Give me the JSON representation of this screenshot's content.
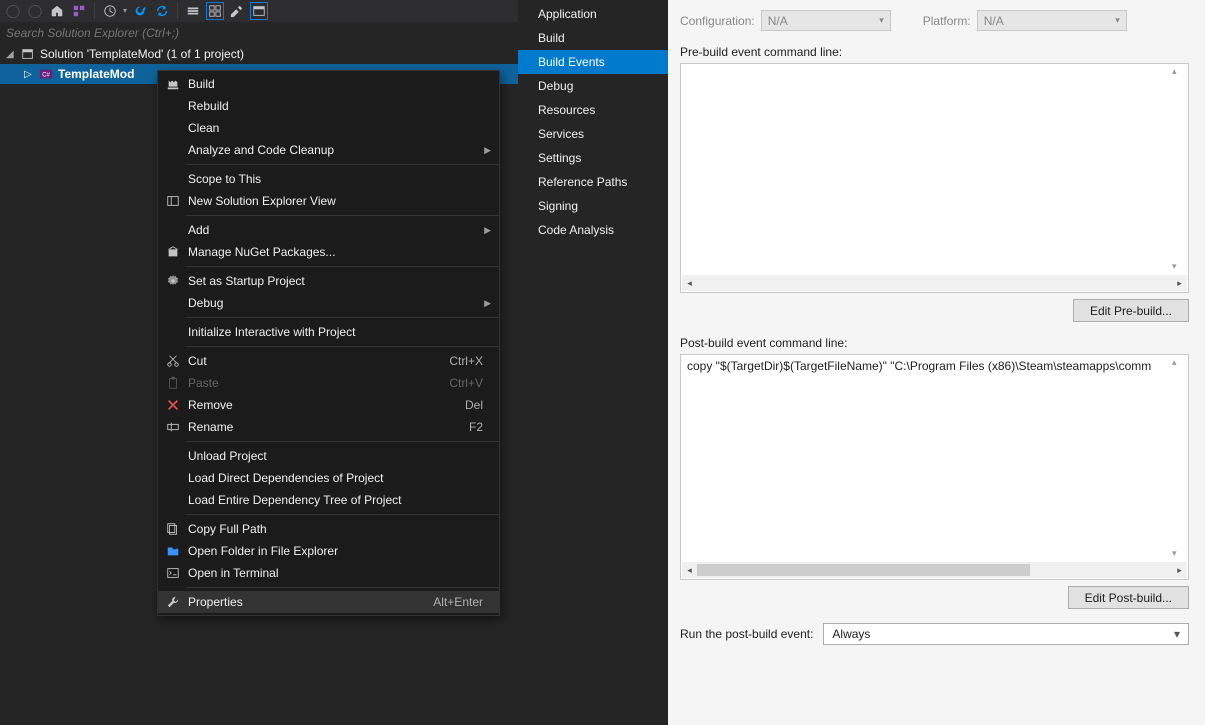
{
  "search": {
    "placeholder": "Search Solution Explorer (Ctrl+;)"
  },
  "solution": {
    "root": "Solution 'TemplateMod' (1 of 1 project)",
    "project": "TemplateMod"
  },
  "contextMenu": [
    {
      "type": "item",
      "label": "Build",
      "icon": "build"
    },
    {
      "type": "item",
      "label": "Rebuild"
    },
    {
      "type": "item",
      "label": "Clean"
    },
    {
      "type": "item",
      "label": "Analyze and Code Cleanup",
      "submenu": true
    },
    {
      "type": "sep"
    },
    {
      "type": "item",
      "label": "Scope to This"
    },
    {
      "type": "item",
      "label": "New Solution Explorer View",
      "icon": "newview"
    },
    {
      "type": "sep"
    },
    {
      "type": "item",
      "label": "Add",
      "submenu": true
    },
    {
      "type": "item",
      "label": "Manage NuGet Packages...",
      "icon": "nuget"
    },
    {
      "type": "sep"
    },
    {
      "type": "item",
      "label": "Set as Startup Project",
      "icon": "gear"
    },
    {
      "type": "item",
      "label": "Debug",
      "submenu": true
    },
    {
      "type": "sep"
    },
    {
      "type": "item",
      "label": "Initialize Interactive with Project"
    },
    {
      "type": "sep"
    },
    {
      "type": "item",
      "label": "Cut",
      "icon": "cut",
      "shortcut": "Ctrl+X"
    },
    {
      "type": "item",
      "label": "Paste",
      "icon": "paste",
      "shortcut": "Ctrl+V",
      "disabled": true
    },
    {
      "type": "item",
      "label": "Remove",
      "icon": "remove",
      "shortcut": "Del"
    },
    {
      "type": "item",
      "label": "Rename",
      "icon": "rename",
      "shortcut": "F2"
    },
    {
      "type": "sep"
    },
    {
      "type": "item",
      "label": "Unload Project"
    },
    {
      "type": "item",
      "label": "Load Direct Dependencies of Project"
    },
    {
      "type": "item",
      "label": "Load Entire Dependency Tree of Project"
    },
    {
      "type": "sep"
    },
    {
      "type": "item",
      "label": "Copy Full Path",
      "icon": "copypath"
    },
    {
      "type": "item",
      "label": "Open Folder in File Explorer",
      "icon": "openfolder"
    },
    {
      "type": "item",
      "label": "Open in Terminal",
      "icon": "terminal"
    },
    {
      "type": "sep"
    },
    {
      "type": "item",
      "label": "Properties",
      "icon": "wrench",
      "shortcut": "Alt+Enter",
      "highlight": true
    }
  ],
  "categories": [
    "Application",
    "Build",
    "Build Events",
    "Debug",
    "Resources",
    "Services",
    "Settings",
    "Reference Paths",
    "Signing",
    "Code Analysis"
  ],
  "categorySelected": "Build Events",
  "config": {
    "configurationLabel": "Configuration:",
    "configurationValue": "N/A",
    "platformLabel": "Platform:",
    "platformValue": "N/A"
  },
  "prebuild": {
    "label": "Pre-build event command line:",
    "value": "",
    "button": "Edit Pre-build..."
  },
  "postbuild": {
    "label": "Post-build event command line:",
    "value": "copy \"$(TargetDir)$(TargetFileName)\" \"C:\\Program Files (x86)\\Steam\\steamapps\\comm",
    "button": "Edit Post-build..."
  },
  "runEvent": {
    "label": "Run the post-build event:",
    "value": "Always"
  }
}
